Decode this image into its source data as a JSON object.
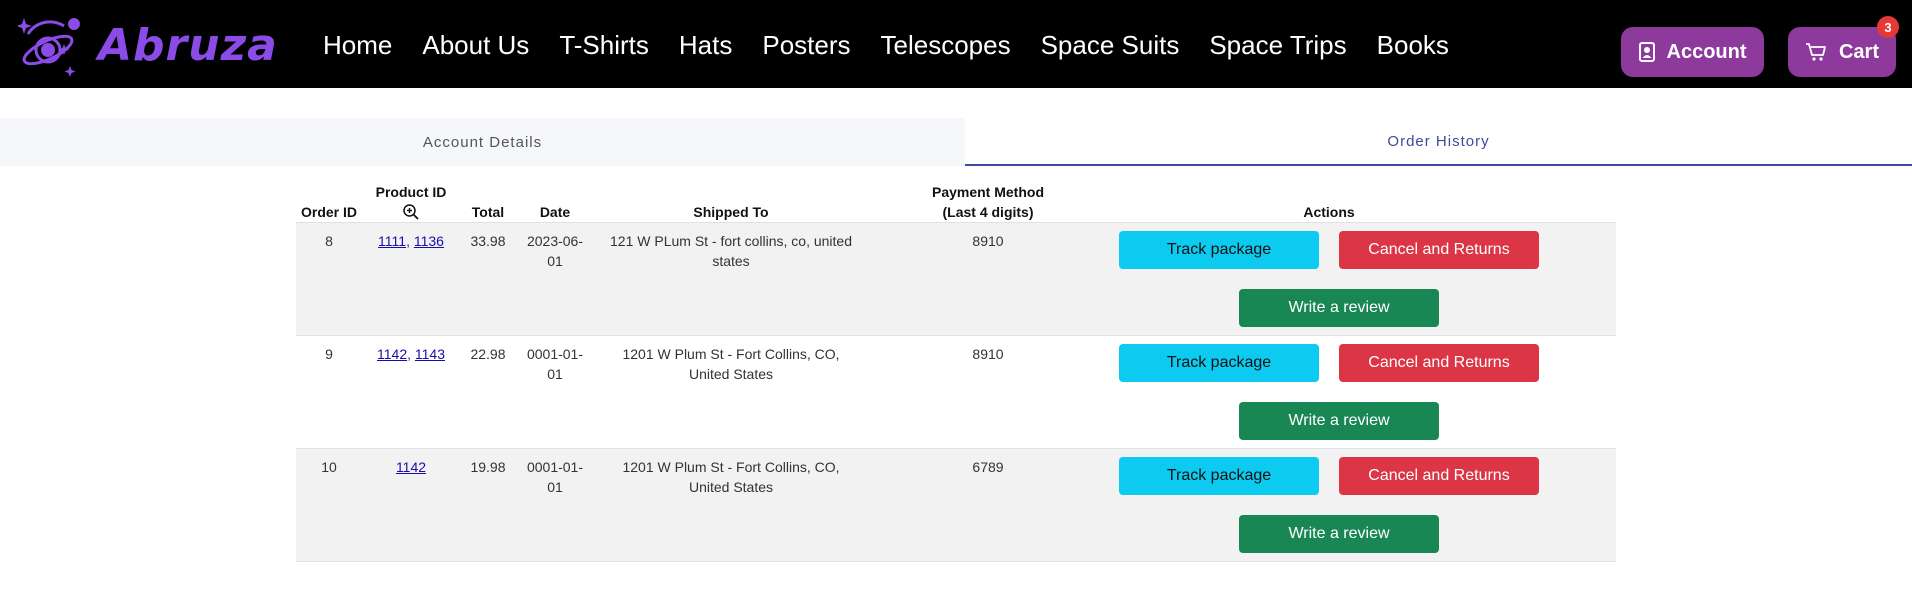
{
  "header": {
    "brand": "Abruza",
    "nav": [
      "Home",
      "About Us",
      "T-Shirts",
      "Hats",
      "Posters",
      "Telescopes",
      "Space Suits",
      "Space Trips",
      "Books"
    ],
    "account_label": "Account",
    "cart_label": "Cart",
    "cart_count": "3"
  },
  "tabs": {
    "account_details": "Account Details",
    "order_history": "Order History"
  },
  "table": {
    "headers": {
      "order_id": "Order ID",
      "product_id": "Product ID",
      "total": "Total",
      "date": "Date",
      "shipped_to": "Shipped To",
      "payment": "Payment Method (Last 4 digits)",
      "actions": "Actions"
    },
    "buttons": {
      "track": "Track package",
      "cancel": "Cancel and Returns",
      "review": "Write a review"
    },
    "rows": [
      {
        "order_id": "8",
        "products": [
          "1111",
          "1136"
        ],
        "total": "33.98",
        "date": "2023-06-01",
        "shipped_to": "121 W PLum St - fort collins, co, united states",
        "payment": "8910"
      },
      {
        "order_id": "9",
        "products": [
          "1142",
          "1143"
        ],
        "total": "22.98",
        "date": "0001-01-01",
        "shipped_to": "1201 W Plum St - Fort Collins, CO, United States",
        "payment": "8910"
      },
      {
        "order_id": "10",
        "products": [
          "1142"
        ],
        "total": "19.98",
        "date": "0001-01-01",
        "shipped_to": "1201 W Plum St - Fort Collins, CO, United States",
        "payment": "6789"
      }
    ]
  },
  "colors": {
    "header_bg": "#000000",
    "brand": "#8b4be6",
    "header_button": "#8e3a9c",
    "track": "#0dcaf0",
    "cancel": "#dc3545",
    "review": "#198754",
    "active_tab": "#3d4a9e"
  },
  "icons": [
    "planet-logo-icon",
    "contact-card-icon",
    "cart-icon",
    "zoom-in-icon"
  ]
}
